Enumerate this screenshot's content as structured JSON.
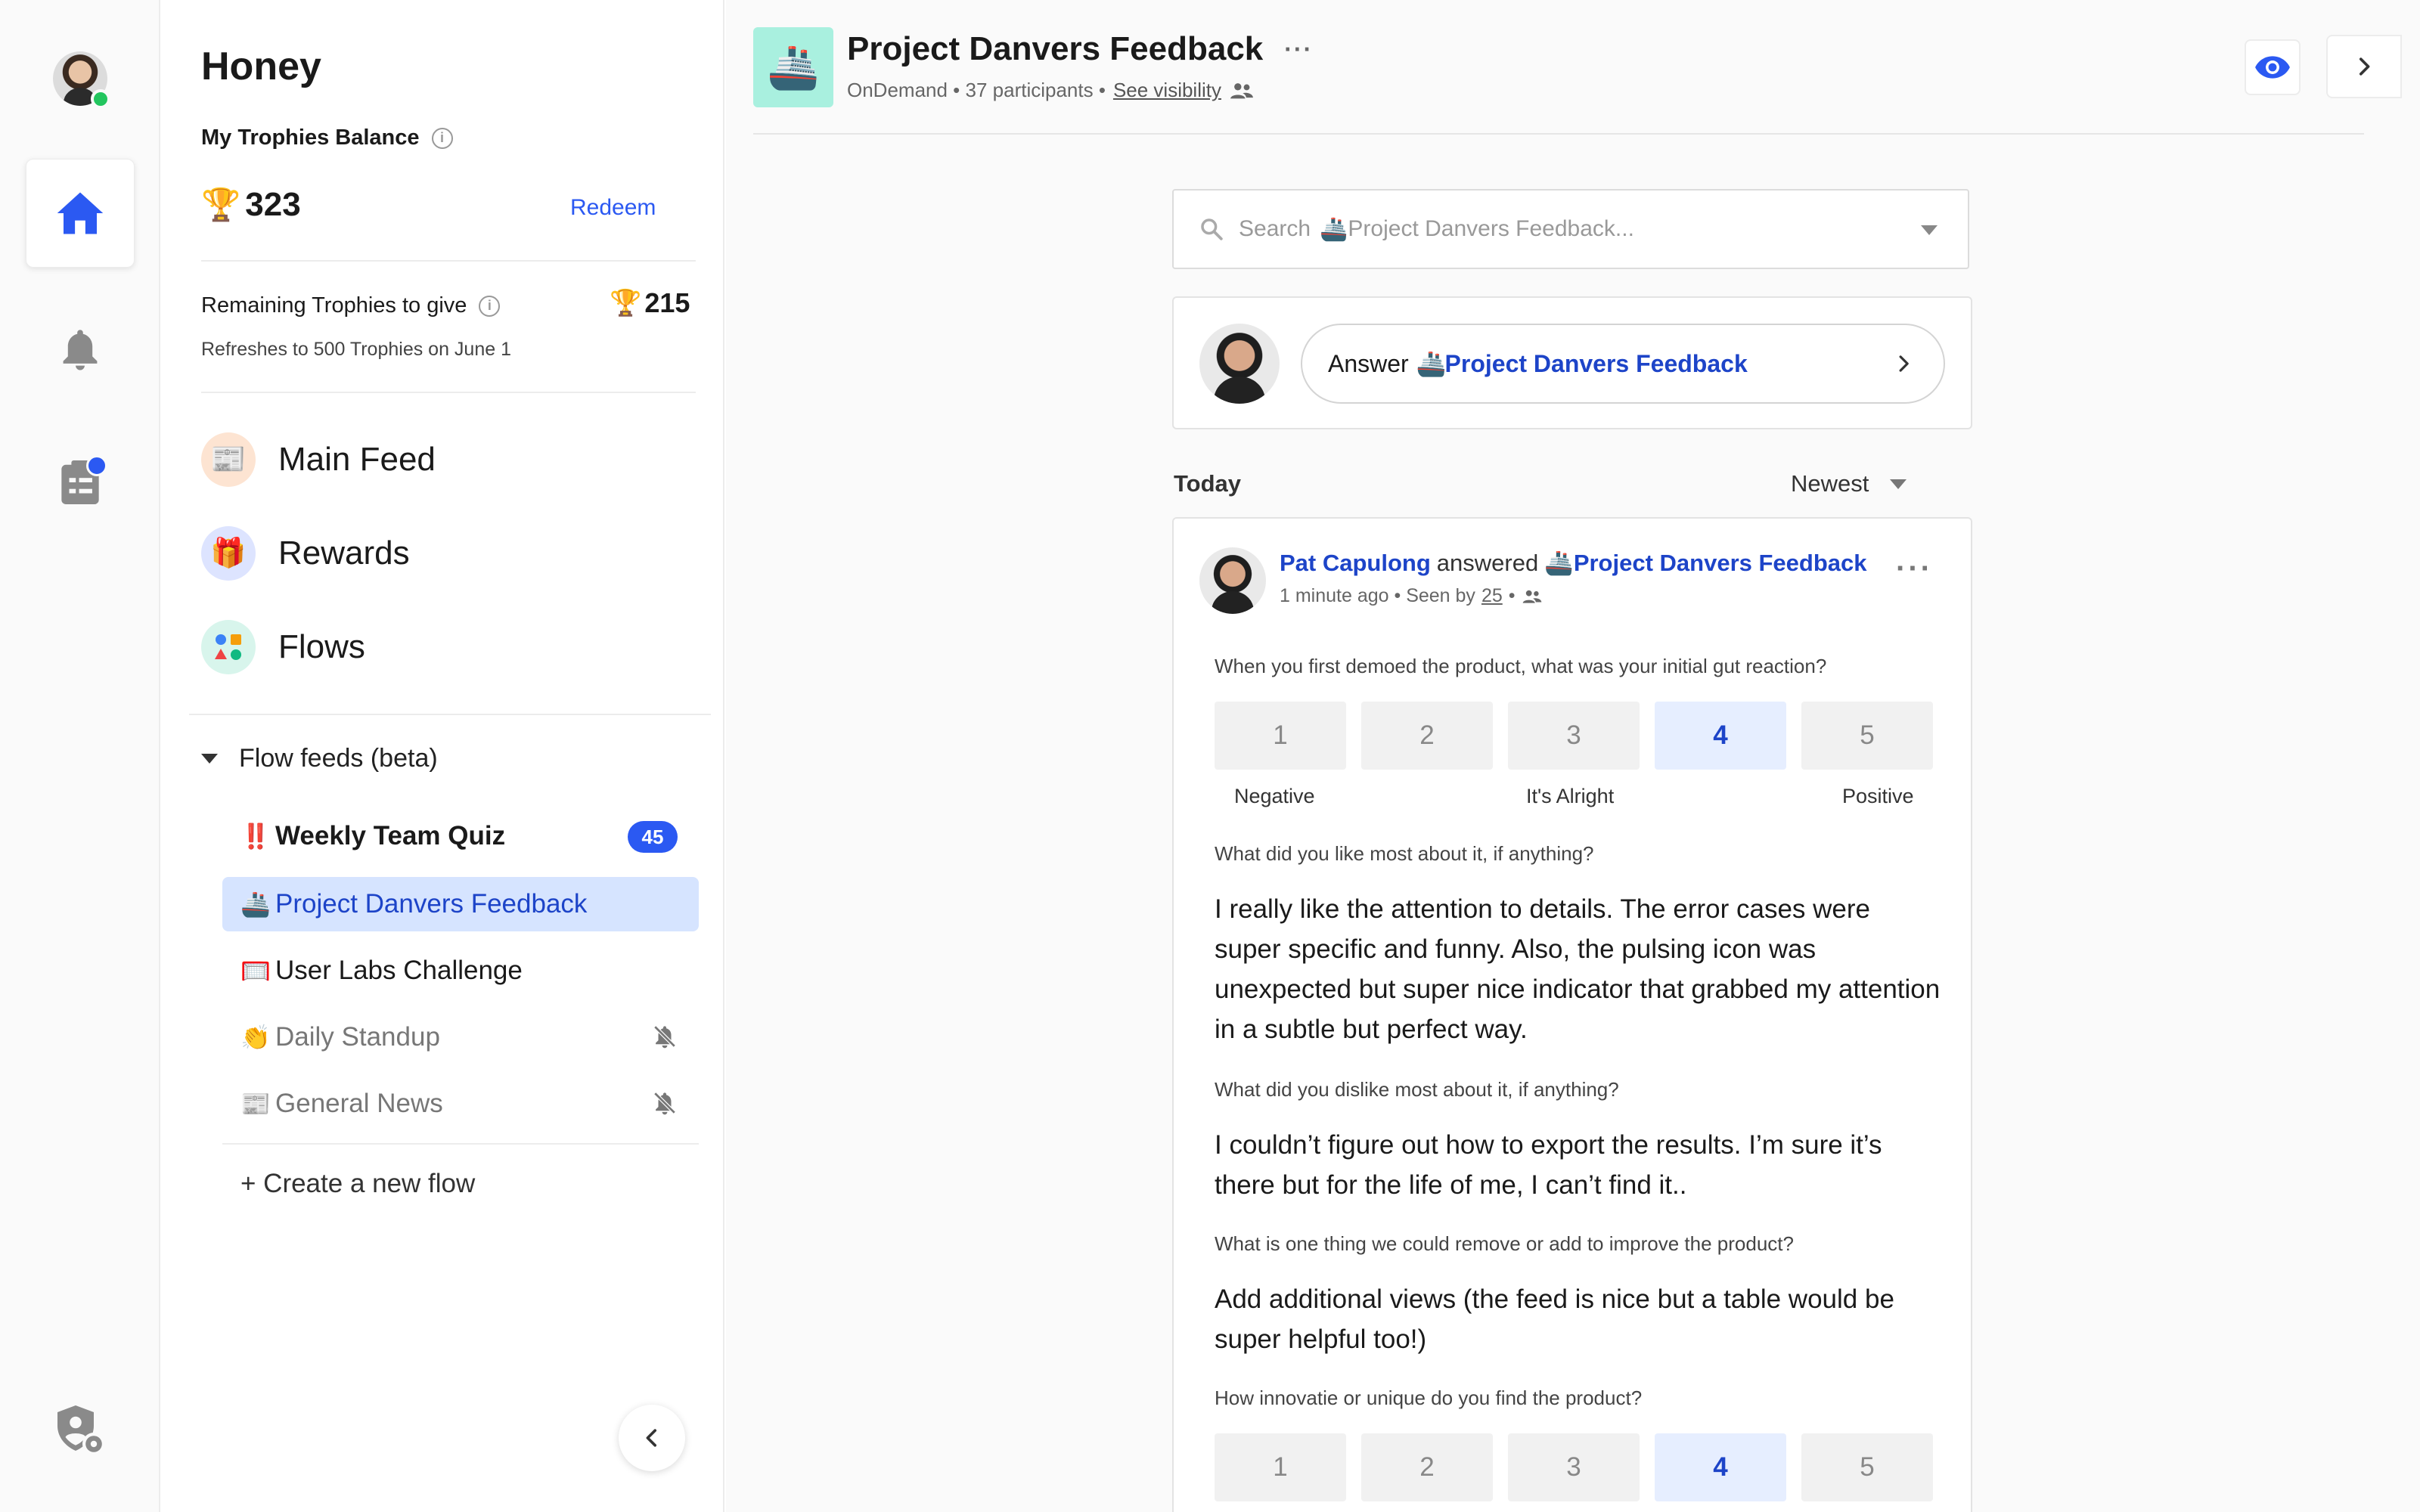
{
  "sidebar": {
    "title": "Honey",
    "balance_label": "My Trophies Balance",
    "balance": "323",
    "redeem": "Redeem",
    "remaining_label": "Remaining Trophies to give",
    "remaining": "215",
    "refresh_text": "Refreshes to 500 Trophies on June 1",
    "nav": [
      {
        "label": "Main Feed",
        "icon": "newspaper"
      },
      {
        "label": "Rewards",
        "icon": "gift"
      },
      {
        "label": "Flows",
        "icon": "flows-shapes"
      }
    ],
    "flow_feeds_label": "Flow feeds (beta)",
    "flows": [
      {
        "emoji": "‼️",
        "label": "Weekly Team Quiz",
        "badge": "45"
      },
      {
        "emoji": "🚢",
        "label": "Project Danvers Feedback"
      },
      {
        "emoji": "🥅",
        "label": "User Labs Challenge"
      },
      {
        "emoji": "👏",
        "label": "Daily Standup"
      },
      {
        "emoji": "📰",
        "label": "General News"
      }
    ],
    "create_flow": "+ Create a new flow"
  },
  "header": {
    "flow_emoji": "🚢",
    "title": "Project Danvers Feedback",
    "more": "···",
    "meta": "OnDemand • 37 participants •",
    "visibility_link": "See visibility"
  },
  "search": {
    "prefix": "Search",
    "emoji": "🚢",
    "placeholder": "Project Danvers Feedback..."
  },
  "answer": {
    "prefix": "Answer",
    "emoji": "🚢",
    "flow": "Project Danvers Feedback"
  },
  "feed": {
    "day": "Today",
    "sort": "Newest"
  },
  "post": {
    "author": "Pat Capulong",
    "verb": "answered",
    "emoji": "🚢",
    "flow": "Project Danvers Feedback",
    "time": "1 minute ago • Seen by",
    "seen_count": "25",
    "seen_sep": "•",
    "more": "···",
    "q1": "When you first demoed the product, what was your initial gut reaction?",
    "scale1": [
      "1",
      "2",
      "3",
      "4",
      "5"
    ],
    "scale1_labels": [
      "Negative",
      "It's Alright",
      "Positive"
    ],
    "q2": "What did you like most about it, if anything?",
    "a2": "I really like the attention to details. The error cases were super specific and funny. Also, the pulsing icon was unexpected but super nice indicator that grabbed my attention in a subtle but perfect way.",
    "q3": "What did you dislike most about it, if anything?",
    "a3": "I couldn’t figure out how to export the results. I’m sure it’s there but for the life of me, I can’t find it..",
    "q4": "What is one thing we could remove or add to improve the product?",
    "a4": "Add additional views (the feed is nice but a table would be super helpful too!)",
    "q5": "How innovatie or unique do you find the product?",
    "scale2": [
      "1",
      "2",
      "3",
      "4",
      "5"
    ]
  },
  "colors": {
    "accent": "#2b59f2",
    "selected_bg": "#d6e4ff",
    "flow_logo_bg": "#a9f0df",
    "online": "#22c55e"
  }
}
